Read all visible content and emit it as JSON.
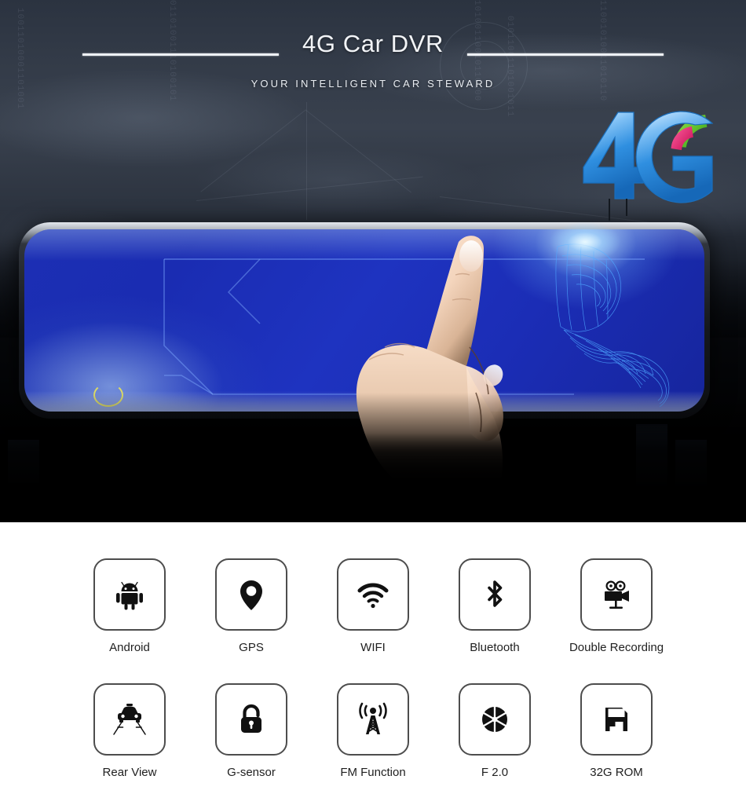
{
  "hero": {
    "title": "4G Car DVR",
    "subtitle": "YOUR INTELLIGENT CAR STEWARD",
    "logo_text": "4G",
    "colors": {
      "sky_top": "#2b3340",
      "sky_mid": "#39414e",
      "hero_bottom": "#000000",
      "screen_blue": "#1e33c0",
      "screen_highlight": "#b4e1ff",
      "logo_blue": "#2f8fe0",
      "logo_green": "#55c423",
      "logo_pink": "#e0125e",
      "rule_white": "#eef1f5",
      "yellow_arc": "#e8e45a"
    },
    "binary_columns": [
      "10011010001101001",
      "01101001110100101",
      "10100110010110100",
      "01011001101001011",
      "11001010011010110"
    ]
  },
  "features": {
    "rows": [
      [
        {
          "icon": "android-icon",
          "label": "Android"
        },
        {
          "icon": "map-pin-icon",
          "label": "GPS"
        },
        {
          "icon": "wifi-icon",
          "label": "WIFI"
        },
        {
          "icon": "bluetooth-icon",
          "label": "Bluetooth"
        },
        {
          "icon": "movie-camera-icon",
          "label": "Double Recording"
        }
      ],
      [
        {
          "icon": "car-lane-icon",
          "label": "Rear View"
        },
        {
          "icon": "padlock-icon",
          "label": "G-sensor"
        },
        {
          "icon": "radio-tower-icon",
          "label": "FM Function"
        },
        {
          "icon": "aperture-icon",
          "label": "F 2.0"
        },
        {
          "icon": "floppy-disk-icon",
          "label": "32G ROM"
        }
      ]
    ],
    "box_border_color": "#4d4d4d",
    "label_color": "#1f1f1f"
  }
}
